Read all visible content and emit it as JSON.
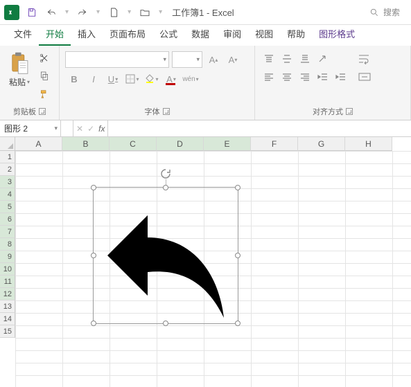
{
  "titlebar": {
    "doc_title": "工作簿1 - Excel",
    "search_placeholder": "搜索"
  },
  "tabs": {
    "file": "文件",
    "home": "开始",
    "insert": "插入",
    "pagelayout": "页面布局",
    "formulas": "公式",
    "data": "数据",
    "review": "审阅",
    "view": "视图",
    "help": "帮助",
    "shapeformat": "图形格式"
  },
  "ribbon": {
    "clipboard": {
      "paste": "粘贴",
      "group": "剪贴板"
    },
    "font": {
      "group": "字体",
      "bold": "B",
      "italic": "I",
      "underline": "U",
      "wen": "wén",
      "fontcolor_letter": "A"
    },
    "align": {
      "group": "对齐方式"
    }
  },
  "namebox": {
    "value": "图形 2"
  },
  "fx": {
    "label": "fx"
  },
  "grid": {
    "cols": [
      "A",
      "B",
      "C",
      "D",
      "E",
      "F",
      "G",
      "H"
    ],
    "rows": [
      "1",
      "2",
      "3",
      "4",
      "5",
      "6",
      "7",
      "8",
      "9",
      "10",
      "11",
      "12",
      "13",
      "14",
      "15"
    ],
    "sel_cols": [
      "B",
      "C",
      "D",
      "E"
    ],
    "sel_rows": [
      "3",
      "4",
      "5",
      "6",
      "7",
      "8",
      "9",
      "10",
      "11",
      "12"
    ]
  },
  "colors": {
    "accent": "#107c41",
    "context": "#5b3a8c"
  }
}
